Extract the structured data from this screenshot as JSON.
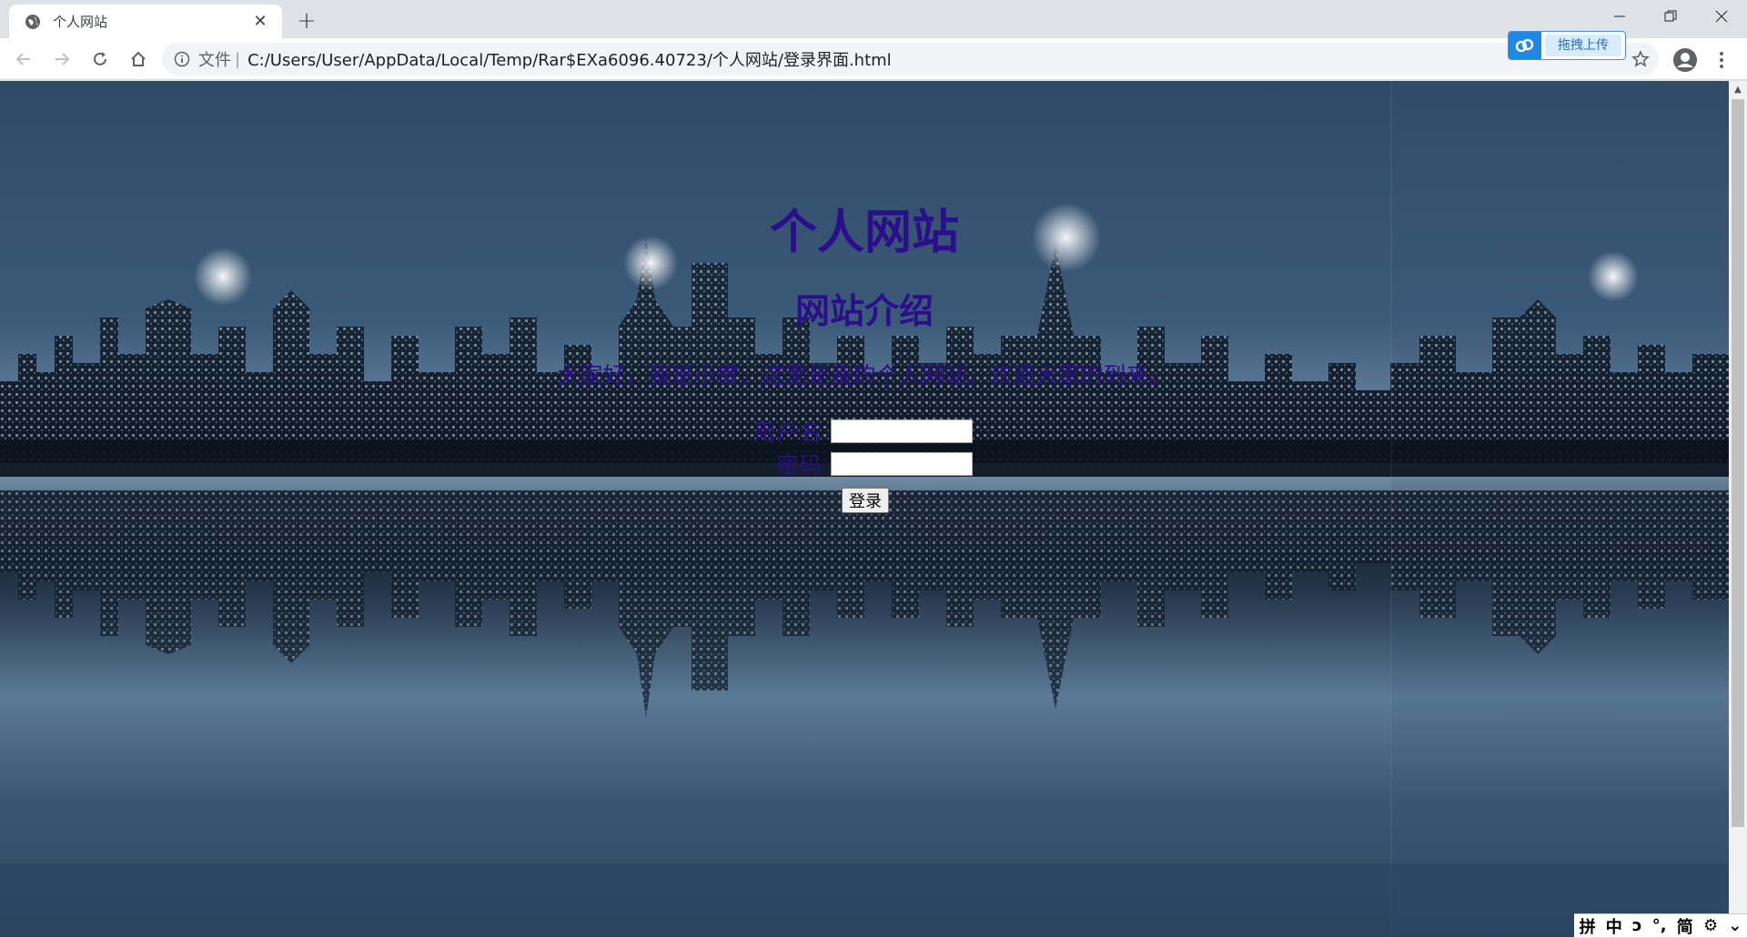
{
  "browser": {
    "tab_title": "个人网站",
    "new_tab_symbol": "+",
    "scheme_label": "文件",
    "separator": "|",
    "url": "C:/Users/User/AppData/Local/Temp/Rar$EXa6096.40723/个人网站/登录界面.html",
    "upload_widget_label": "拖拽上传"
  },
  "page": {
    "title": "个人网站",
    "subtitle": "网站介绍",
    "intro": "大家好，我是小雪，这里是我的个人网站，欢迎大家的到来。",
    "username_label": "用户名",
    "password_label": "密码",
    "username_value": "",
    "password_value": "",
    "login_button": "登录"
  },
  "ime": {
    "items": [
      "拼",
      "中",
      "ɔ",
      "°,",
      "简",
      "⚙",
      "⌄"
    ]
  },
  "colors": {
    "heading": "#2a0e8c",
    "tab_bg": "#dee1e6",
    "accent_upload": "#1e88e5"
  }
}
